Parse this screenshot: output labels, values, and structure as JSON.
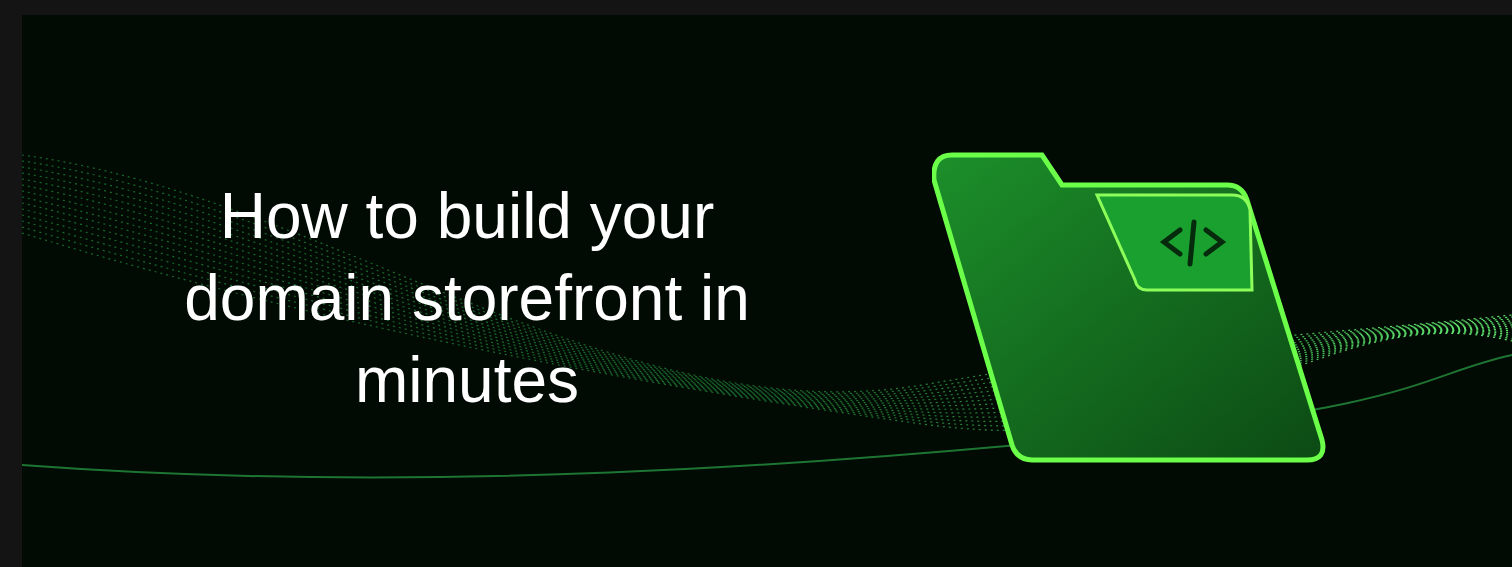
{
  "banner": {
    "headline": "How to build your domain storefront in minutes"
  }
}
